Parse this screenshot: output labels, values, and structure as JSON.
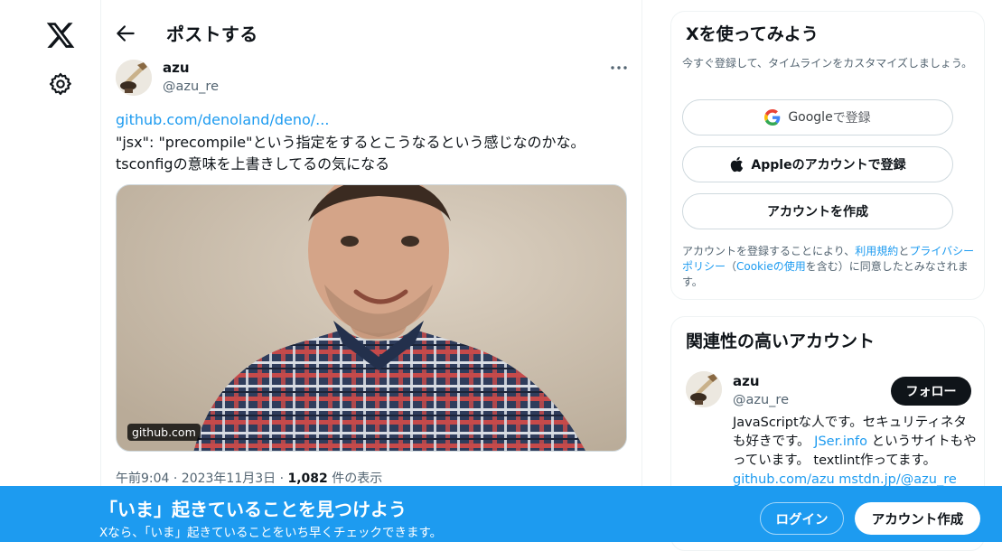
{
  "nav": {
    "logo_icon": "x-logo-icon",
    "settings_icon": "gear-icon"
  },
  "header": {
    "title": "ポストする"
  },
  "post": {
    "author_name": "azu",
    "author_handle": "@azu_re",
    "link": "github.com/denoland/deno/...",
    "text_line1": "\"jsx\": \"precompile\"という指定をするとこうなるという感じなのかな。",
    "text_line2": "tsconfigの意味を上書きしてるの気になる",
    "card_domain": "github.com",
    "timestamp": "午前9:04 · 2023年11月3日 · ",
    "views_count": "1,082",
    "views_label": " 件の表示"
  },
  "signup": {
    "title": "Xを使ってみよう",
    "description": "今すぐ登録して、タイムラインをカスタマイズしましょう。",
    "google_label": "Google",
    "google_suffix": " で登録",
    "apple_label": "Appleのアカウントで登録",
    "create_label": "アカウントを作成",
    "terms_prefix": "アカウントを登録することにより、",
    "terms_link1": "利用規約",
    "terms_and": "と",
    "terms_link2": "プライバシーポリシー",
    "terms_mid1": "（",
    "terms_link3": "Cookieの使用",
    "terms_suffix": "を含む）に同意したとみなされます。"
  },
  "related": {
    "title": "関連性の高いアカウント",
    "name": "azu",
    "handle": "@azu_re",
    "follow_label": "フォロー",
    "bio1": "JavaScriptな人です。セキュリティネタも好きです。 ",
    "bio_link1": "JSer.info",
    "bio2": " というサイトもやっています。 textlint作ってます。",
    "bio_link2": "github.com/azu",
    "bio_link3": "mstdn.jp/@azu_re"
  },
  "bottom_bar": {
    "title": "「いま」起きていることを見つけよう",
    "subtitle": "Xなら、「いま」起きていることをいち早くチェックできます。",
    "login_label": "ログイン",
    "signup_label": "アカウント作成"
  },
  "colors": {
    "accent": "#1d9bf0",
    "text": "#0f1419",
    "muted": "#536471"
  }
}
